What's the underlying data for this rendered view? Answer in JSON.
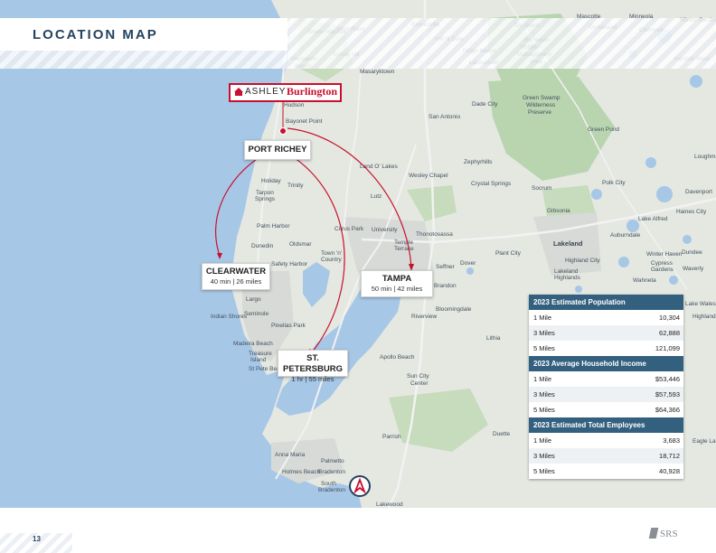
{
  "header": {
    "title": "LOCATION MAP"
  },
  "brand": {
    "name_left": "ASHLEY",
    "name_right": "Burlington"
  },
  "locations": [
    {
      "name": "PORT RICHEY",
      "detail": ""
    },
    {
      "name": "CLEARWATER",
      "detail": "40 min | 26 miles"
    },
    {
      "name": "TAMPA",
      "detail": "50 min | 42 miles"
    },
    {
      "name": "ST. PETERSBURG",
      "detail": "1 hr | 55 miles"
    }
  ],
  "map_labels": {
    "cities": [
      "Brooksville",
      "Hill N Dale",
      "Ridge Manor",
      "Lacoochee",
      "Tarrytown",
      "Mascotte",
      "Groveland",
      "Minneola",
      "Winter Garden",
      "Clermont",
      "Horizon West",
      "Weeki Wachee",
      "High Point",
      "Spring Hill",
      "Hernando Beach",
      "Masaryktown",
      "Hudson",
      "Bayonet Point",
      "San Antonio",
      "Dade City",
      "Zephyrhills",
      "Land O' Lakes",
      "Wesley Chapel",
      "Crystal Springs",
      "Holiday",
      "Tarpon Springs",
      "Trinity",
      "Lutz",
      "Palm Harbor",
      "Dunedin",
      "Citrus Park",
      "Oldsmar",
      "Town 'n' Country",
      "Safety Harbor",
      "University",
      "Temple Terrace",
      "Thonotosassa",
      "Plant City",
      "Dover",
      "Seffner",
      "Brandon",
      "Largo",
      "Indian Shores",
      "Seminole",
      "Pinellas Park",
      "Madeira Beach",
      "Treasure Island",
      "St Pete Beach",
      "Riverview",
      "Bloomingdale",
      "Lithia",
      "Apollo Beach",
      "Sun City Center",
      "Anna Maria",
      "Holmes Beach",
      "Palmetto",
      "Bradenton",
      "South Bradenton",
      "Parrish",
      "Duette",
      "Lakewood",
      "Polk City",
      "Lakeland",
      "Auburndale",
      "Lake Alfred",
      "Haines City",
      "Davenport",
      "Winter Haven",
      "Dundee",
      "Lake Wales",
      "Socrum",
      "Gibsonia",
      "Highland City",
      "Lakeland Highlands",
      "Wahneta",
      "Cypress Gardens",
      "Waverly",
      "Lake Wales",
      "Highland Park",
      "Eagle Lake",
      "Green Pond",
      "Loughman"
    ],
    "parks": [
      "Richloam Wildlife Management Area",
      "Green Swamp Wilderness Preserve"
    ]
  },
  "stats": {
    "sections": [
      {
        "heading": "2023 Estimated Population",
        "rows": [
          {
            "label": "1 Mile",
            "value": "10,304"
          },
          {
            "label": "3 Miles",
            "value": "62,888"
          },
          {
            "label": "5 Miles",
            "value": "121,099"
          }
        ]
      },
      {
        "heading": "2023 Average Household Income",
        "rows": [
          {
            "label": "1 Mile",
            "value": "$53,446"
          },
          {
            "label": "3 Miles",
            "value": "$57,593"
          },
          {
            "label": "5 Miles",
            "value": "$64,366"
          }
        ]
      },
      {
        "heading": "2023 Estimated Total Employees",
        "rows": [
          {
            "label": "1 Mile",
            "value": "3,683"
          },
          {
            "label": "3 Miles",
            "value": "18,712"
          },
          {
            "label": "5 Miles",
            "value": "40,928"
          }
        ]
      }
    ]
  },
  "footer": {
    "page_number": "13",
    "logo": "SRS"
  },
  "colors": {
    "navy": "#23435e",
    "table_header": "#34607f",
    "route_red": "#c8102e",
    "water": "#a7c7e6",
    "land": "#e4e8e1",
    "park_green": "#b9d5b0"
  }
}
